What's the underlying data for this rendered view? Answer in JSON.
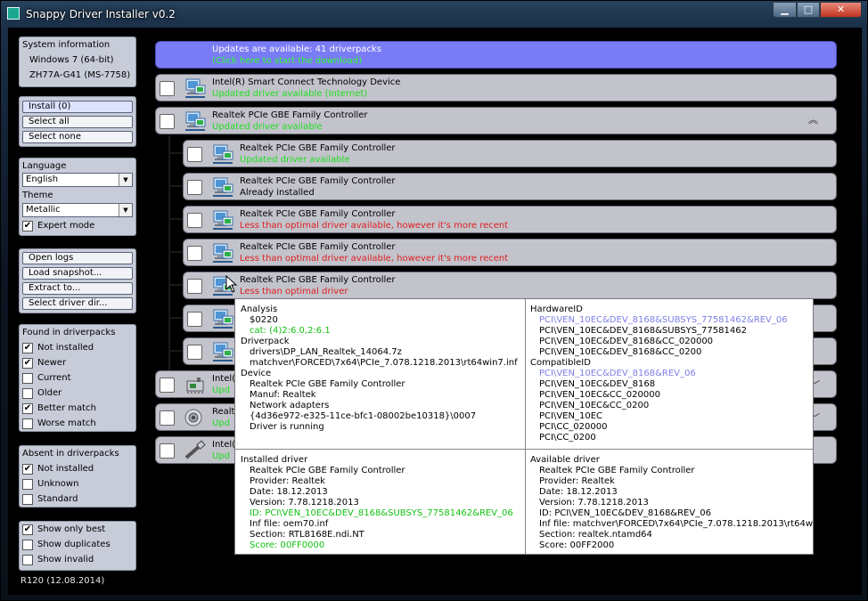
{
  "window": {
    "title": "Snappy Driver Installer v0.2",
    "min_glyph": "▁",
    "max_glyph": "□",
    "close_glyph": "✕"
  },
  "sysinfo": {
    "header": "System information",
    "os": "Windows 7 (64-bit)",
    "board": "ZH77A-G41 (MS-7758)"
  },
  "actions": {
    "install": "Install (0)",
    "select_all": "Select all",
    "select_none": "Select none"
  },
  "settings": {
    "language_label": "Language",
    "language_value": "English",
    "theme_label": "Theme",
    "theme_value": "Metallic",
    "expert_mode": "Expert mode"
  },
  "tools": {
    "open_logs": "Open logs",
    "load_snapshot": "Load snapshot...",
    "extract_to": "Extract to...",
    "select_driver_dir": "Select driver dir..."
  },
  "found": {
    "header": "Found in driverpacks",
    "items": [
      {
        "label": "Not installed",
        "mark": "✔"
      },
      {
        "label": "Newer",
        "mark": "✔"
      },
      {
        "label": "Current",
        "mark": ""
      },
      {
        "label": "Older",
        "mark": ""
      },
      {
        "label": "Better match",
        "mark": "✔"
      },
      {
        "label": "Worse match",
        "mark": ""
      }
    ]
  },
  "absent": {
    "header": "Absent in driverpacks",
    "items": [
      {
        "label": "Not installed",
        "mark": "✔"
      },
      {
        "label": "Unknown",
        "mark": ""
      },
      {
        "label": "Standard",
        "mark": ""
      }
    ]
  },
  "view": {
    "items": [
      {
        "label": "Show only best",
        "mark": "✔"
      },
      {
        "label": "Show duplicates",
        "mark": ""
      },
      {
        "label": "Show invalid",
        "mark": ""
      }
    ]
  },
  "version": "R120 (12.08.2014)",
  "banner": {
    "line1": "Updates are available: 41 driverpacks",
    "line2": "(Click here to start the download)"
  },
  "rows": [
    {
      "name": "Intel(R) Smart Connect Technology Device",
      "status": "Updated driver available (Internet)"
    },
    {
      "name": "Realtek PCIe GBE Family Controller",
      "status": "Updated driver available",
      "collapse_glyph": "︽"
    },
    {
      "name": "Realtek PCIe GBE Family Controller",
      "status": "Updated driver available"
    },
    {
      "name": "Realtek PCIe GBE Family Controller",
      "status": "Already installed"
    },
    {
      "name": "Realtek PCIe GBE Family Controller",
      "status": "Less than optimal driver available, however it's more recent"
    },
    {
      "name": "Realtek PCIe GBE Family Controller",
      "status": "Less than optimal driver available, however it's more recent"
    },
    {
      "name": "Realtek PCIe GBE Family Controller",
      "status": "Less than optimal driver"
    },
    {
      "name": "",
      "status": ""
    },
    {
      "name": "",
      "status": ""
    },
    {
      "name": "Intel(",
      "status": "Upd",
      "side_glyph": "﹀"
    },
    {
      "name": "Realte",
      "status": "Upd",
      "side_glyph": "﹀"
    },
    {
      "name": "Intel(",
      "status": "Upd"
    }
  ],
  "popup": {
    "analysis": {
      "header": "Analysis",
      "code": "$0220",
      "cat": "cat: (4)2:6.0,2:6.1"
    },
    "driverpack": {
      "header": "Driverpack",
      "path": "drivers\\DP_LAN_Realtek_14064.7z",
      "inf": "matchver\\FORCED\\7x64\\PCIe_7.078.1218.2013\\rt64win7.inf"
    },
    "device": {
      "header": "Device",
      "name": "Realtek PCIe GBE Family Controller",
      "manuf": "Manuf: Realtek",
      "class": "Network adapters",
      "guid": "{4d36e972-e325-11ce-bfc1-08002be10318}\\0007",
      "state": "Driver is running"
    },
    "hardware_ids": {
      "header": "HardwareID",
      "items": [
        "PCI\\VEN_10EC&DEV_8168&SUBSYS_77581462&REV_06",
        "PCI\\VEN_10EC&DEV_8168&SUBSYS_77581462",
        "PCI\\VEN_10EC&DEV_8168&CC_020000",
        "PCI\\VEN_10EC&DEV_8168&CC_0200"
      ]
    },
    "compatible_ids": {
      "header": "CompatibleID",
      "items": [
        "PCI\\VEN_10EC&DEV_8168&REV_06",
        "PCI\\VEN_10EC&DEV_8168",
        "PCI\\VEN_10EC&CC_020000",
        "PCI\\VEN_10EC&CC_0200",
        "PCI\\VEN_10EC",
        "PCI\\CC_020000",
        "PCI\\CC_0200"
      ]
    },
    "installed": {
      "header": "Installed driver",
      "name": "Realtek PCIe GBE Family Controller",
      "provider": "Provider: Realtek",
      "date": "Date: 18.12.2013",
      "version": "Version: 7.78.1218.2013",
      "id": "ID: PCI\\VEN_10EC&DEV_8168&SUBSYS_77581462&REV_06",
      "inf": "Inf file: oem70.inf",
      "section": "Section: RTL8168E.ndi.NT",
      "score": "Score: 00FF0000"
    },
    "available": {
      "header": "Available driver",
      "name": "Realtek PCIe GBE Family Controller",
      "provider": "Provider: Realtek",
      "date": "Date: 18.12.2013",
      "version": "Version: 7.78.1218.2013",
      "id": "ID: PCI\\VEN_10EC&DEV_8168&REV_06",
      "inf": "Inf file: matchver\\FORCED\\7x64\\PCIe_7.078.1218.2013\\rt64win7.inf",
      "section": "Section: realtek.ntamd64",
      "score": "Score: 00FF2000"
    }
  },
  "colors": {
    "banner": "#7a7cf6",
    "status_green": "#1fe01f",
    "status_red": "#e02020",
    "popup_blue": "#7f7fe8"
  }
}
